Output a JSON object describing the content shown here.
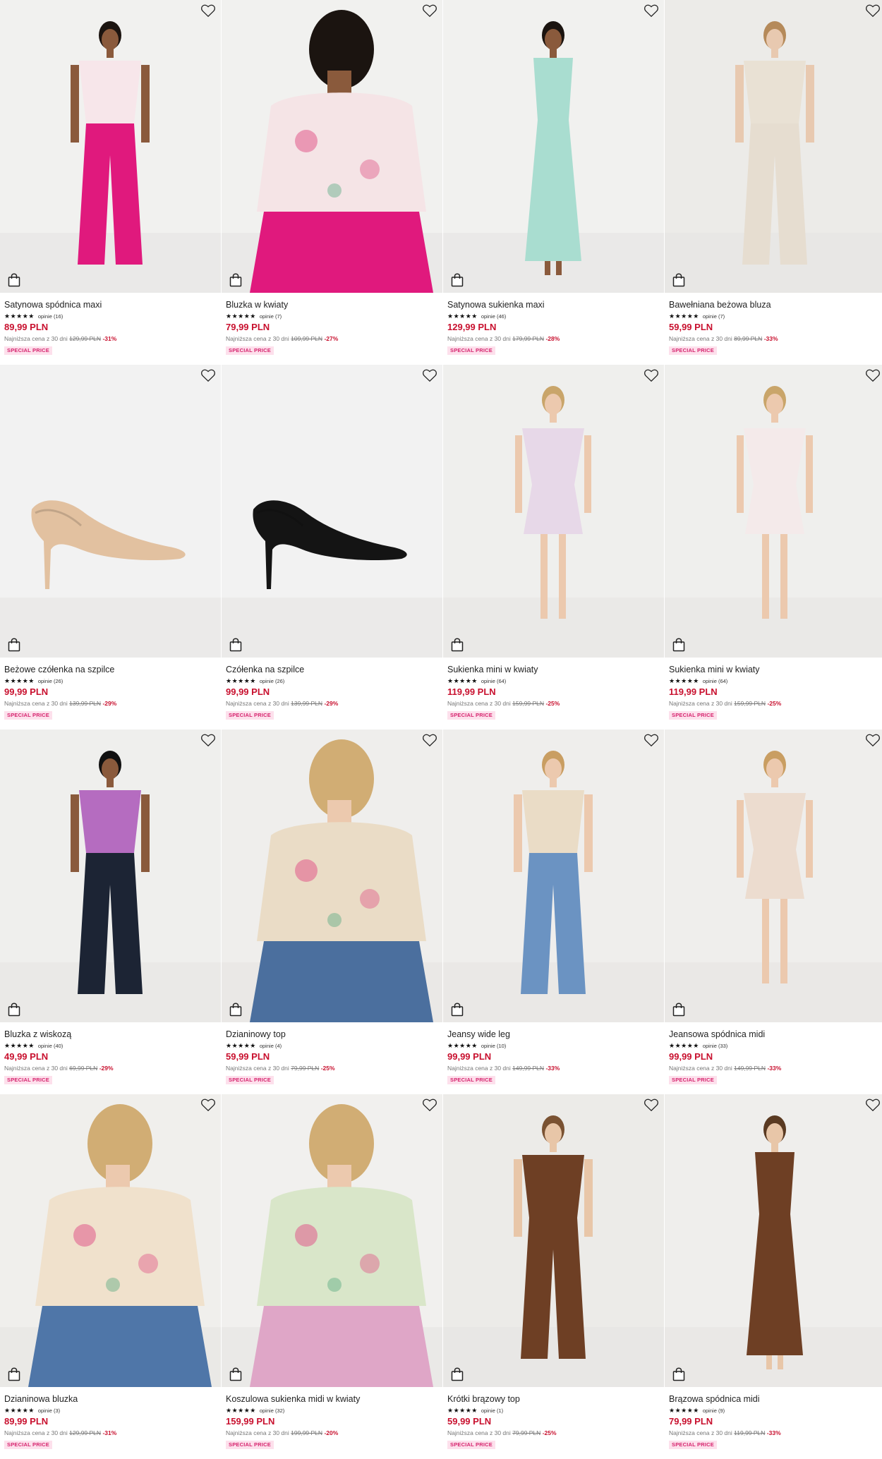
{
  "labels": {
    "lowest_prefix": "Najniższa cena z 30 dni",
    "badge": "SPECIAL PRICE",
    "favorite_icon": "heart-outline-icon",
    "bag_icon": "shopping-bag-icon"
  },
  "products": [
    {
      "name": "Satynowa spódnica maxi",
      "rating": "★★★★★",
      "reviews": "opinie (16)",
      "price": "89,99 PLN",
      "old_price": "129,99 PLN",
      "discount": "-31%",
      "badge": "SPECIAL PRICE",
      "scene": {
        "bg": "#f1f1ef",
        "type": "person",
        "top": "#f7e6ea",
        "bottom": "#e0197d",
        "skin": "#8a5a3c",
        "hair": "#1b1410"
      }
    },
    {
      "name": "Bluzka w kwiaty",
      "rating": "★★★★★",
      "reviews": "opinie (7)",
      "price": "79,99 PLN",
      "old_price": "109,99 PLN",
      "discount": "-27%",
      "badge": "SPECIAL PRICE",
      "scene": {
        "bg": "#f1f1ef",
        "type": "closeback",
        "top": "#f5e4e6",
        "bottom": "#e0197d",
        "skin": "#8a5a3c",
        "hair": "#1b1410"
      }
    },
    {
      "name": "Satynowa sukienka maxi",
      "rating": "★★★★★",
      "reviews": "opinie (46)",
      "price": "129,99 PLN",
      "old_price": "179,99 PLN",
      "discount": "-28%",
      "badge": "SPECIAL PRICE",
      "scene": {
        "bg": "#f1f1ef",
        "type": "dress",
        "top": "#a9ddd0",
        "bottom": "#a9ddd0",
        "skin": "#8a5a3c",
        "hair": "#1b1410"
      }
    },
    {
      "name": "Bawełniana beżowa bluza",
      "rating": "★★★★★",
      "reviews": "opinie (7)",
      "price": "59,99 PLN",
      "old_price": "89,99 PLN",
      "discount": "-33%",
      "badge": "SPECIAL PRICE",
      "scene": {
        "bg": "#ecebe8",
        "type": "person",
        "top": "#e9e1d4",
        "bottom": "#e6ddd0",
        "skin": "#e8c9b0",
        "hair": "#b58a5a"
      }
    },
    {
      "name": "Beżowe czółenka na szpilce",
      "rating": "★★★★★",
      "reviews": "opinie (26)",
      "price": "99,99 PLN",
      "old_price": "139,99 PLN",
      "discount": "-29%",
      "badge": "SPECIAL PRICE",
      "scene": {
        "bg": "#f2f2f2",
        "type": "shoe",
        "top": "#e2c1a0",
        "bottom": "#e2c1a0",
        "skin": "#e2c1a0",
        "hair": "#e2c1a0"
      }
    },
    {
      "name": "Czółenka na szpilce",
      "rating": "★★★★★",
      "reviews": "opinie (26)",
      "price": "99,99 PLN",
      "old_price": "139,99 PLN",
      "discount": "-29%",
      "badge": "SPECIAL PRICE",
      "scene": {
        "bg": "#f2f2f2",
        "type": "shoe",
        "top": "#141414",
        "bottom": "#141414",
        "skin": "#141414",
        "hair": "#141414"
      }
    },
    {
      "name": "Sukienka mini w kwiaty",
      "rating": "★★★★★",
      "reviews": "opinie (64)",
      "price": "119,99 PLN",
      "old_price": "159,99 PLN",
      "discount": "-25%",
      "badge": "SPECIAL PRICE",
      "scene": {
        "bg": "#efefed",
        "type": "minidress",
        "top": "#e7d8e8",
        "bottom": "#e2d3e6",
        "skin": "#ecc9ae",
        "hair": "#c9a56a"
      }
    },
    {
      "name": "Sukienka mini w kwiaty",
      "rating": "★★★★★",
      "reviews": "opinie (64)",
      "price": "119,99 PLN",
      "old_price": "159,99 PLN",
      "discount": "-25%",
      "badge": "SPECIAL PRICE",
      "scene": {
        "bg": "#efefed",
        "type": "minidress",
        "top": "#f4eaea",
        "bottom": "#f2e6e6",
        "skin": "#ecc9ae",
        "hair": "#c9a56a"
      }
    },
    {
      "name": "Bluzka z wiskozą",
      "rating": "★★★★★",
      "reviews": "opinie (40)",
      "price": "49,99 PLN",
      "old_price": "69,99 PLN",
      "discount": "-29%",
      "badge": "SPECIAL PRICE",
      "scene": {
        "bg": "#efefed",
        "type": "person",
        "top": "#b56cc0",
        "bottom": "#1c2434",
        "skin": "#8a5a3c",
        "hair": "#111111"
      }
    },
    {
      "name": "Dzianinowy top",
      "rating": "★★★★★",
      "reviews": "opinie (4)",
      "price": "59,99 PLN",
      "old_price": "79,99 PLN",
      "discount": "-25%",
      "badge": "SPECIAL PRICE",
      "scene": {
        "bg": "#efeeec",
        "type": "closeback",
        "top": "#eadcc6",
        "bottom": "#4b6f9e",
        "skin": "#ecc9ae",
        "hair": "#d1ad74"
      }
    },
    {
      "name": "Jeansy wide leg",
      "rating": "★★★★★",
      "reviews": "opinie (10)",
      "price": "99,99 PLN",
      "old_price": "149,99 PLN",
      "discount": "-33%",
      "badge": "SPECIAL PRICE",
      "scene": {
        "bg": "#efeeec",
        "type": "person",
        "top": "#eadcc6",
        "bottom": "#6b93c2",
        "skin": "#ecc9ae",
        "hair": "#c99e62"
      }
    },
    {
      "name": "Jeansowa spódnica midi",
      "rating": "★★★★★",
      "reviews": "opinie (33)",
      "price": "99,99 PLN",
      "old_price": "149,99 PLN",
      "discount": "-33%",
      "badge": "SPECIAL PRICE",
      "scene": {
        "bg": "#efeeec",
        "type": "minidress",
        "top": "#ecdccf",
        "bottom": "#5f88bb",
        "skin": "#ecc9ae",
        "hair": "#c99e62"
      }
    },
    {
      "name": "Dzianinowa bluzka",
      "rating": "★★★★★",
      "reviews": "opinie (3)",
      "price": "89,99 PLN",
      "old_price": "129,99 PLN",
      "discount": "-31%",
      "badge": "SPECIAL PRICE",
      "scene": {
        "bg": "#f0efec",
        "type": "closeback",
        "top": "#f0e1cc",
        "bottom": "#4f76a8",
        "skin": "#ecc9ae",
        "hair": "#d1ad74"
      }
    },
    {
      "name": "Koszulowa sukienka midi w kwiaty",
      "rating": "★★★★★",
      "reviews": "opinie (32)",
      "price": "159,99 PLN",
      "old_price": "199,99 PLN",
      "discount": "-20%",
      "badge": "SPECIAL PRICE",
      "scene": {
        "bg": "#f1f0ee",
        "type": "closeback",
        "top": "#d9e6c9",
        "bottom": "#dfa6c7",
        "skin": "#ecc9ae",
        "hair": "#d1ad74"
      }
    },
    {
      "name": "Krótki brązowy top",
      "rating": "★★★★★",
      "reviews": "opinie (1)",
      "price": "59,99 PLN",
      "old_price": "79,99 PLN",
      "discount": "-25%",
      "badge": "SPECIAL PRICE",
      "scene": {
        "bg": "#ecebe8",
        "type": "person",
        "top": "#6e3f24",
        "bottom": "#6e3f24",
        "skin": "#e8c6a8",
        "hair": "#7a5232"
      }
    },
    {
      "name": "Brązowa spódnica midi",
      "rating": "★★★★★",
      "reviews": "opinie (9)",
      "price": "79,99 PLN",
      "old_price": "119,99 PLN",
      "discount": "-33%",
      "badge": "SPECIAL PRICE",
      "scene": {
        "bg": "#efeeec",
        "type": "dress",
        "top": "#6e3f24",
        "bottom": "#6e3f24",
        "skin": "#e8c6a8",
        "hair": "#5a3a22"
      }
    }
  ]
}
